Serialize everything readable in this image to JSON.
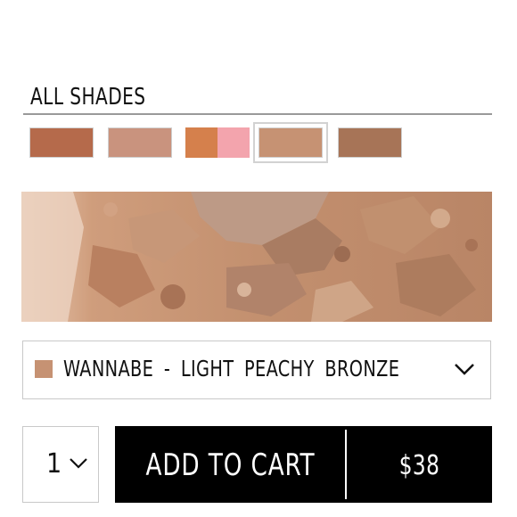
{
  "shades": {
    "heading": "ALL SHADES",
    "swatches": [
      {
        "name": "swatch-1",
        "colors": [
          "#b56a4b"
        ],
        "selected": false
      },
      {
        "name": "swatch-2",
        "colors": [
          "#c9937e"
        ],
        "selected": false
      },
      {
        "name": "swatch-3",
        "colors": [
          "#d5804c",
          "#f3a4ad"
        ],
        "selected": false
      },
      {
        "name": "swatch-4",
        "colors": [
          "#c69273"
        ],
        "selected": true
      },
      {
        "name": "swatch-5",
        "colors": [
          "#a77457"
        ],
        "selected": false
      }
    ]
  },
  "texture": {
    "icon": "powder-texture-image",
    "base_color": "#c89a7a"
  },
  "shade_select": {
    "chip_color": "#c69273",
    "selected_label": "WANNABE - LIGHT PEACHY BRONZE",
    "icon": "chevron-down-icon"
  },
  "quantity": {
    "value": "1",
    "icon": "chevron-down-icon"
  },
  "cart": {
    "label": "ADD TO CART",
    "price": "$38"
  },
  "colors": {
    "button_bg": "#000000",
    "button_text": "#ffffff",
    "border": "#c9c9c9"
  }
}
